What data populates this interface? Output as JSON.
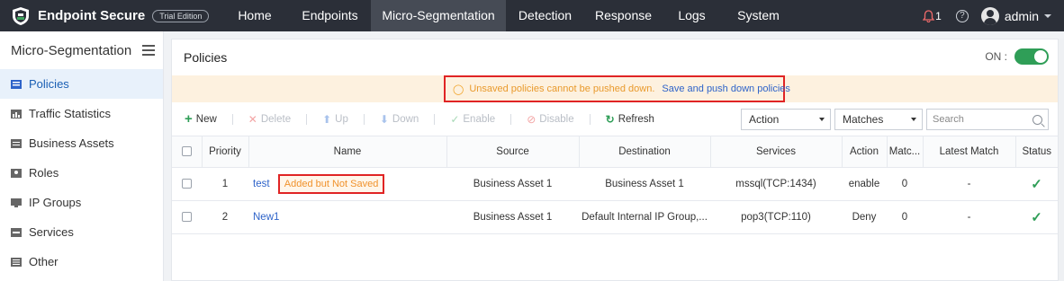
{
  "header": {
    "app_name": "Endpoint Secure",
    "edition": "Trial Edition",
    "nav": [
      {
        "label": "Home"
      },
      {
        "label": "Endpoints"
      },
      {
        "label": "Micro-Segmentation",
        "active": true
      },
      {
        "label": "Detection"
      },
      {
        "label": "Response"
      },
      {
        "label": "Logs"
      },
      {
        "label": "System"
      }
    ],
    "alerts_count": "1",
    "help_icon": "?",
    "username": "admin"
  },
  "sidebar": {
    "title": "Micro-Segmentation",
    "items": [
      {
        "label": "Policies",
        "active": true
      },
      {
        "label": "Traffic Statistics"
      },
      {
        "label": "Business Assets"
      },
      {
        "label": "Roles"
      },
      {
        "label": "IP Groups"
      },
      {
        "label": "Services"
      },
      {
        "label": "Other"
      }
    ]
  },
  "main": {
    "title": "Policies",
    "toggle_label": "ON :",
    "toggle_on": true
  },
  "warning": {
    "text": "Unsaved policies cannot be pushed down.",
    "link": "Save and push down policies"
  },
  "toolbar": {
    "new": "New",
    "delete": "Delete",
    "up": "Up",
    "down": "Down",
    "enable": "Enable",
    "disable": "Disable",
    "refresh": "Refresh",
    "action_select": "Action",
    "matches_select": "Matches",
    "search_placeholder": "Search"
  },
  "table": {
    "columns": [
      "",
      "Priority",
      "Name",
      "Source",
      "Destination",
      "Services",
      "Action",
      "Matc...",
      "Latest Match",
      "Status"
    ],
    "rows": [
      {
        "priority": "1",
        "name": "test",
        "tag": "Added but Not Saved",
        "source": "Business Asset 1",
        "destination": "Business Asset 1",
        "services": "mssql(TCP:1434)",
        "action": "enable",
        "matches": "0",
        "latest_match": "-",
        "status": "✓"
      },
      {
        "priority": "2",
        "name": "New1",
        "tag": "",
        "source": "Business Asset 1",
        "destination": "Default Internal IP Group,...",
        "services": "pop3(TCP:110)",
        "action": "Deny",
        "matches": "0",
        "latest_match": "-",
        "status": "✓"
      }
    ]
  },
  "colors": {
    "topbar": "#2b2f38",
    "accent": "#2e63c9",
    "warning_bg": "#fdf1df",
    "highlight_border": "#e02424",
    "success": "#2f9e57"
  }
}
